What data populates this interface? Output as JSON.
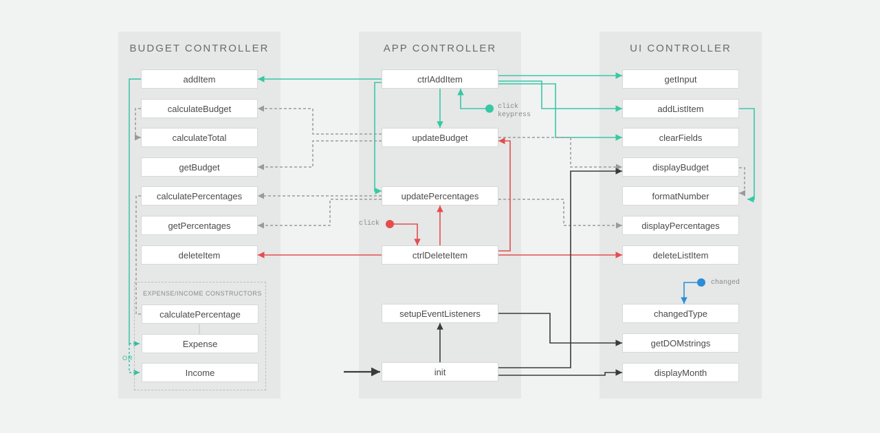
{
  "columns": {
    "budget": {
      "title": "BUDGET CONTROLLER"
    },
    "app": {
      "title": "APP CONTROLLER"
    },
    "ui": {
      "title": "UI CONTROLLER"
    }
  },
  "budget_nodes": {
    "addItem": "addItem",
    "calculateBudget": "calculateBudget",
    "calculateTotal": "calculateTotal",
    "getBudget": "getBudget",
    "calculatePercentages": "calculatePercentages",
    "getPercentages": "getPercentages",
    "deleteItem": "deleteItem"
  },
  "constructors": {
    "panelTitle": "EXPENSE/INCOME CONSTRUCTORS",
    "calculatePercentage": "calculatePercentage",
    "expense": "Expense",
    "income": "Income",
    "or": "OR"
  },
  "app_nodes": {
    "ctrlAddItem": "ctrlAddItem",
    "updateBudget": "updateBudget",
    "updatePercentages": "updatePercentages",
    "ctrlDeleteItem": "ctrlDeleteItem",
    "setupEventListeners": "setupEventListeners",
    "init": "init"
  },
  "ui_nodes": {
    "getInput": "getInput",
    "addListItem": "addListItem",
    "clearFields": "clearFields",
    "displayBudget": "displayBudget",
    "formatNumber": "formatNumber",
    "displayPercentages": "displayPercentages",
    "deleteListItem": "deleteListItem",
    "changedType": "changedType",
    "getDOMstrings": "getDOMstrings",
    "displayMonth": "displayMonth"
  },
  "events": {
    "clickKeypress": "click\nkeypress",
    "click": "click",
    "changed": "changed"
  },
  "colors": {
    "teal": "#37c8a5",
    "red": "#e44d4d",
    "dark": "#3a3a3a",
    "blue": "#2b8ed6",
    "dash": "#9a9a9a"
  }
}
